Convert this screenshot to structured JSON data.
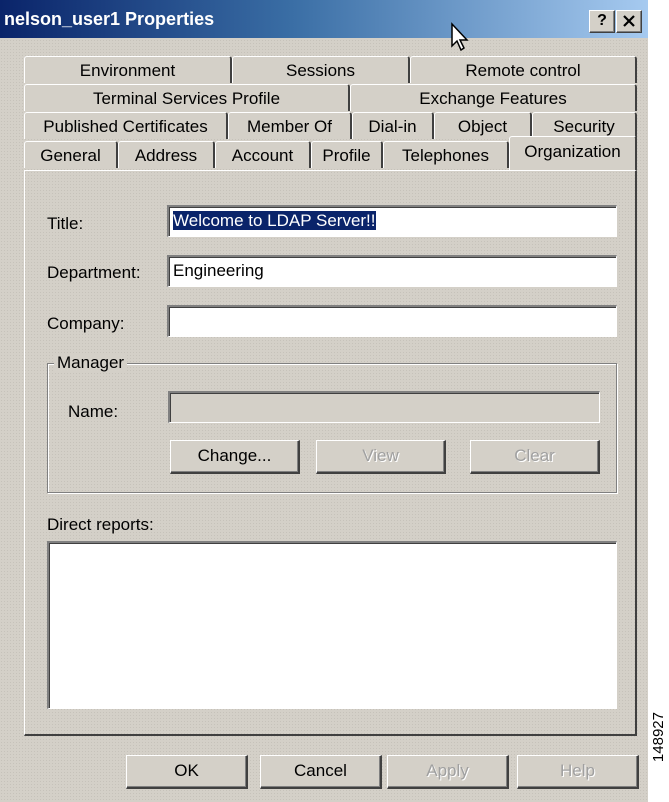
{
  "window": {
    "title": "nelson_user1 Properties",
    "help_label": "?",
    "close_label": "✕"
  },
  "tabs": {
    "row1": [
      "Environment",
      "Sessions",
      "Remote control"
    ],
    "row2": [
      "Terminal Services Profile",
      "Exchange Features"
    ],
    "row3": [
      "Published Certificates",
      "Member Of",
      "Dial-in",
      "Object",
      "Security"
    ],
    "row4": [
      "General",
      "Address",
      "Account",
      "Profile",
      "Telephones",
      "Organization"
    ],
    "active": "Organization"
  },
  "form": {
    "title_label": "Title:",
    "title_value": "Welcome to LDAP Server!!",
    "department_label": "Department:",
    "department_value": "Engineering",
    "company_label": "Company:",
    "company_value": ""
  },
  "manager": {
    "group_label": "Manager",
    "name_label": "Name:",
    "name_value": "",
    "change_label": "Change...",
    "view_label": "View",
    "clear_label": "Clear"
  },
  "direct_reports": {
    "label": "Direct reports:",
    "items": []
  },
  "footer": {
    "ok_label": "OK",
    "cancel_label": "Cancel",
    "apply_label": "Apply",
    "help_label": "Help"
  },
  "figure_id": "148927"
}
